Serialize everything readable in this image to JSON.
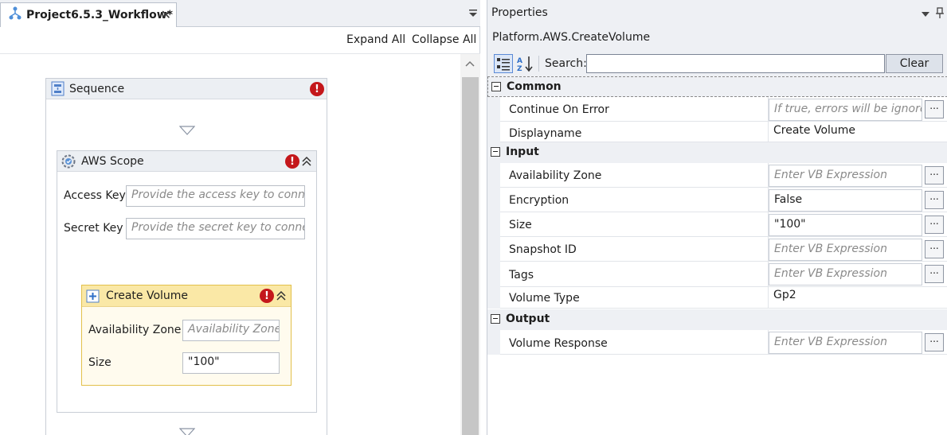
{
  "designer": {
    "tab_title": "Project6.5.3_Workflow*",
    "tab_close": "✕",
    "expand_all": "Expand All",
    "collapse_all": "Collapse All",
    "sequence": {
      "title": "Sequence",
      "error": "!"
    },
    "aws_scope": {
      "title": "AWS Scope",
      "error": "!",
      "access_key_label": "Access Key",
      "access_key_placeholder": "Provide the access key to connect",
      "secret_key_label": "Secret Key",
      "secret_key_placeholder": "Provide the secret key to connect"
    },
    "create_volume": {
      "title": "Create Volume",
      "error": "!",
      "availability_zone_label": "Availability Zone",
      "availability_zone_placeholder": "Availability Zone",
      "size_label": "Size",
      "size_value": "\"100\""
    }
  },
  "properties": {
    "title": "Properties",
    "type_name": "Platform.AWS.CreateVolume",
    "search_label": "Search:",
    "search_value": "",
    "clear_label": "Clear",
    "ellipsis": "...",
    "categories": {
      "common": "Common",
      "input": "Input",
      "output": "Output"
    },
    "rows": {
      "continue_on_error": {
        "name": "Continue On Error",
        "value": "If true, errors will be ignored"
      },
      "displayname": {
        "name": "Displayname",
        "value": "Create Volume"
      },
      "availability_zone": {
        "name": "Availability Zone",
        "value": "Enter VB Expression"
      },
      "encryption": {
        "name": "Encryption",
        "value": "False"
      },
      "size": {
        "name": "Size",
        "value": "\"100\""
      },
      "snapshot_id": {
        "name": "Snapshot ID",
        "value": "Enter VB Expression"
      },
      "tags": {
        "name": "Tags",
        "value": "Enter VB Expression"
      },
      "volume_type": {
        "name": "Volume Type",
        "value": "Gp2"
      },
      "volume_response": {
        "name": "Volume Response",
        "value": "Enter VB Expression"
      }
    }
  },
  "colors": {
    "error_badge": "#c4171b",
    "create_volume_header": "#fae8a6",
    "create_volume_border": "#e2c04a",
    "panel_bg": "#eef0f4"
  }
}
